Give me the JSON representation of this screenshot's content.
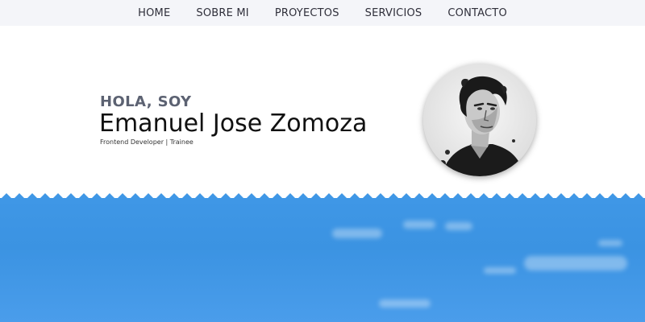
{
  "nav": {
    "items": [
      {
        "label": "HOME"
      },
      {
        "label": "SOBRE MI"
      },
      {
        "label": "PROYECTOS"
      },
      {
        "label": "SERVICIOS"
      },
      {
        "label": "CONTACTO"
      }
    ]
  },
  "hero": {
    "greeting": "HOLA, SOY",
    "name": "Emanuel Jose Zomoza",
    "role": "Frontend Developer | Trainee",
    "avatar_icon": "portrait-photo"
  },
  "colors": {
    "nav_bg": "#f4f5f9",
    "greeting": "#5c6272",
    "sky": "#3f97e6"
  }
}
